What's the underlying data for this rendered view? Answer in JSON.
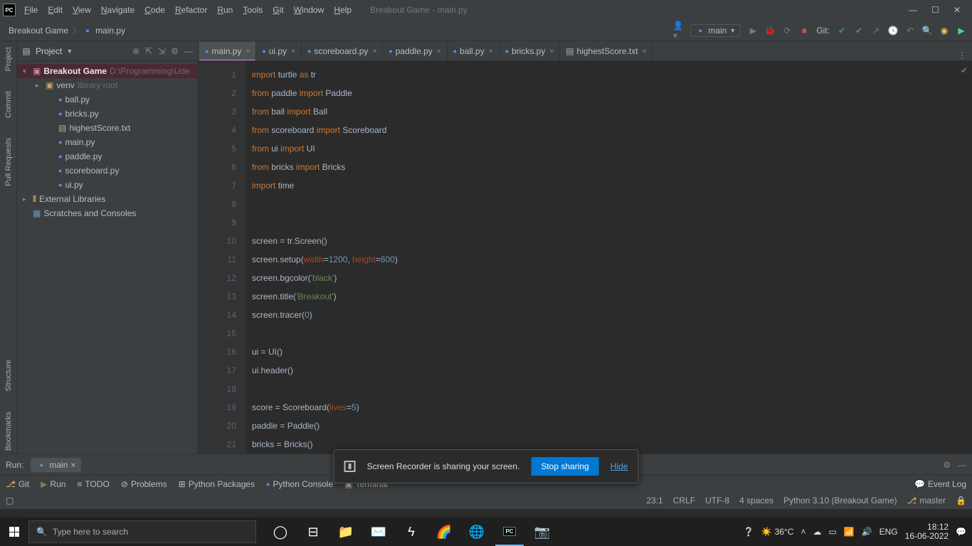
{
  "app_title": "Breakout Game - main.py",
  "menubar": [
    "File",
    "Edit",
    "View",
    "Navigate",
    "Code",
    "Refactor",
    "Run",
    "Tools",
    "Git",
    "Window",
    "Help"
  ],
  "breadcrumb": [
    "Breakout Game",
    "main.py"
  ],
  "run_config": "main",
  "vcs_label": "Git:",
  "left_tools": [
    "Project",
    "Commit",
    "Pull Requests",
    "Structure",
    "Bookmarks"
  ],
  "project_panel": {
    "title": "Project",
    "root": {
      "name": "Breakout Game",
      "path": "D:\\Programming\\Ude"
    },
    "venv": {
      "name": "venv",
      "tag": "library root"
    },
    "files": [
      "ball.py",
      "bricks.py",
      "highestScore.txt",
      "main.py",
      "paddle.py",
      "scoreboard.py",
      "ui.py"
    ],
    "ext_libs": "External Libraries",
    "scratches": "Scratches and Consoles"
  },
  "tabs": [
    {
      "name": "main.py",
      "icon": "py",
      "active": true
    },
    {
      "name": "ui.py",
      "icon": "py"
    },
    {
      "name": "scoreboard.py",
      "icon": "py"
    },
    {
      "name": "paddle.py",
      "icon": "py"
    },
    {
      "name": "ball.py",
      "icon": "py"
    },
    {
      "name": "bricks.py",
      "icon": "py"
    },
    {
      "name": "highestScore.txt",
      "icon": "txt"
    }
  ],
  "run_tool": {
    "label": "Run:",
    "tab": "main"
  },
  "bottom_tabs": {
    "git": "Git",
    "run": "Run",
    "todo": "TODO",
    "problems": "Problems",
    "python_packages": "Python Packages",
    "python_console": "Python Console",
    "terminal": "Terminal",
    "event_log": "Event Log"
  },
  "status": {
    "pos": "23:1",
    "crlf": "CRLF",
    "enc": "UTF-8",
    "spaces": "4 spaces",
    "interp": "Python 3.10 (Breakout Game)",
    "branch": "master"
  },
  "share": {
    "msg": "Screen Recorder is sharing your screen.",
    "stop": "Stop sharing",
    "hide": "Hide"
  },
  "win_search": "Type here to search",
  "tray": {
    "temp": "36°C",
    "lang": "ENG",
    "time": "18:12",
    "date": "16-06-2022"
  },
  "code_lines": [
    {
      "n": 1,
      "raw": "import turtle as tr",
      "html": "<span class='kw'>import </span>turtle <span class='kw'>as </span>tr"
    },
    {
      "n": 2,
      "raw": "from paddle import Paddle",
      "html": "<span class='kw'>from </span>paddle <span class='kw'>import </span>Paddle"
    },
    {
      "n": 3,
      "raw": "from ball import Ball",
      "html": "<span class='kw'>from </span>ball <span class='kw'>import </span>Ball"
    },
    {
      "n": 4,
      "raw": "from scoreboard import Scoreboard",
      "html": "<span class='kw'>from </span>scoreboard <span class='kw'>import </span>Scoreboard"
    },
    {
      "n": 5,
      "raw": "from ui import UI",
      "html": "<span class='kw'>from </span>ui <span class='kw'>import </span>UI"
    },
    {
      "n": 6,
      "raw": "from bricks import Bricks",
      "html": "<span class='kw'>from </span>bricks <span class='kw'>import </span>Bricks"
    },
    {
      "n": 7,
      "raw": "import time",
      "html": "<span class='kw'>import </span>time"
    },
    {
      "n": 8,
      "raw": "",
      "html": ""
    },
    {
      "n": 9,
      "raw": "",
      "html": ""
    },
    {
      "n": 10,
      "raw": "screen = tr.Screen()",
      "html": "screen = tr.Screen()"
    },
    {
      "n": 11,
      "raw": "screen.setup(width=1200, height=600)",
      "html": "screen.setup(<span class='param'>width</span>=<span class='num'>1200</span>, <span class='param'>height</span>=<span class='num'>600</span>)"
    },
    {
      "n": 12,
      "raw": "screen.bgcolor('black')",
      "html": "screen.bgcolor(<span class='str'>'black'</span>)"
    },
    {
      "n": 13,
      "raw": "screen.title('Breakout')",
      "html": "screen.title(<span class='str'>'Breakout'</span>)"
    },
    {
      "n": 14,
      "raw": "screen.tracer(0)",
      "html": "screen.tracer(<span class='num'>0</span>)"
    },
    {
      "n": 15,
      "raw": "",
      "html": ""
    },
    {
      "n": 16,
      "raw": "ui = UI()",
      "html": "ui = UI()"
    },
    {
      "n": 17,
      "raw": "ui.header()",
      "html": "ui.header()"
    },
    {
      "n": 18,
      "raw": "",
      "html": ""
    },
    {
      "n": 19,
      "raw": "score = Scoreboard(lives=5)",
      "html": "score = Scoreboard(<span class='param'>lives</span>=<span class='num'>5</span>)"
    },
    {
      "n": 20,
      "raw": "paddle = Paddle()",
      "html": "paddle = Paddle()"
    },
    {
      "n": 21,
      "raw": "bricks = Bricks()",
      "html": "bricks = Bricks()"
    }
  ]
}
